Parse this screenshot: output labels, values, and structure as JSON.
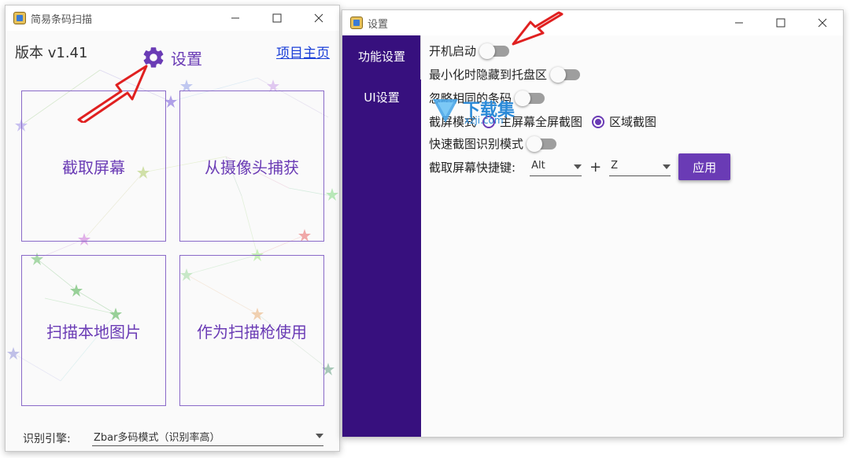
{
  "main_window": {
    "title": "简易条码扫描",
    "version": "版本 v1.41",
    "settings_label": "设置",
    "home_link": "项目主页",
    "buttons": {
      "capture_screen": "截取屏幕",
      "camera_capture": "从摄像头捕获",
      "scan_local_image": "扫描本地图片",
      "use_as_scanner": "作为扫描枪使用"
    },
    "engine_label": "识别引擎:",
    "engine_value": "Zbar多码模式（识别率高）"
  },
  "settings_window": {
    "title": "设置",
    "sidebar": [
      {
        "label": "功能设置"
      },
      {
        "label": "UI设置"
      }
    ],
    "options": {
      "autostart": "开机启动",
      "minimize_to_tray": "最小化时隐藏到托盘区",
      "ignore_same": "忽略相同的条码",
      "capture_mode": "截屏模式",
      "fullscreen_label": "主屏幕全屏截图",
      "region_label": "区域截图",
      "quick_mode": "快速截图识别模式",
      "hotkey_label": "截取屏幕快捷键:",
      "hotkey_modifier": "Alt",
      "hotkey_plus": "+",
      "hotkey_key": "Z",
      "apply": "应用"
    }
  },
  "watermark": {
    "text": "下载集",
    "sub": "xzji.com"
  },
  "colors": {
    "accent": "#6a3bb5",
    "sidebar": "#37107e",
    "link": "#1a3fd8",
    "arrow": "#e02020"
  }
}
